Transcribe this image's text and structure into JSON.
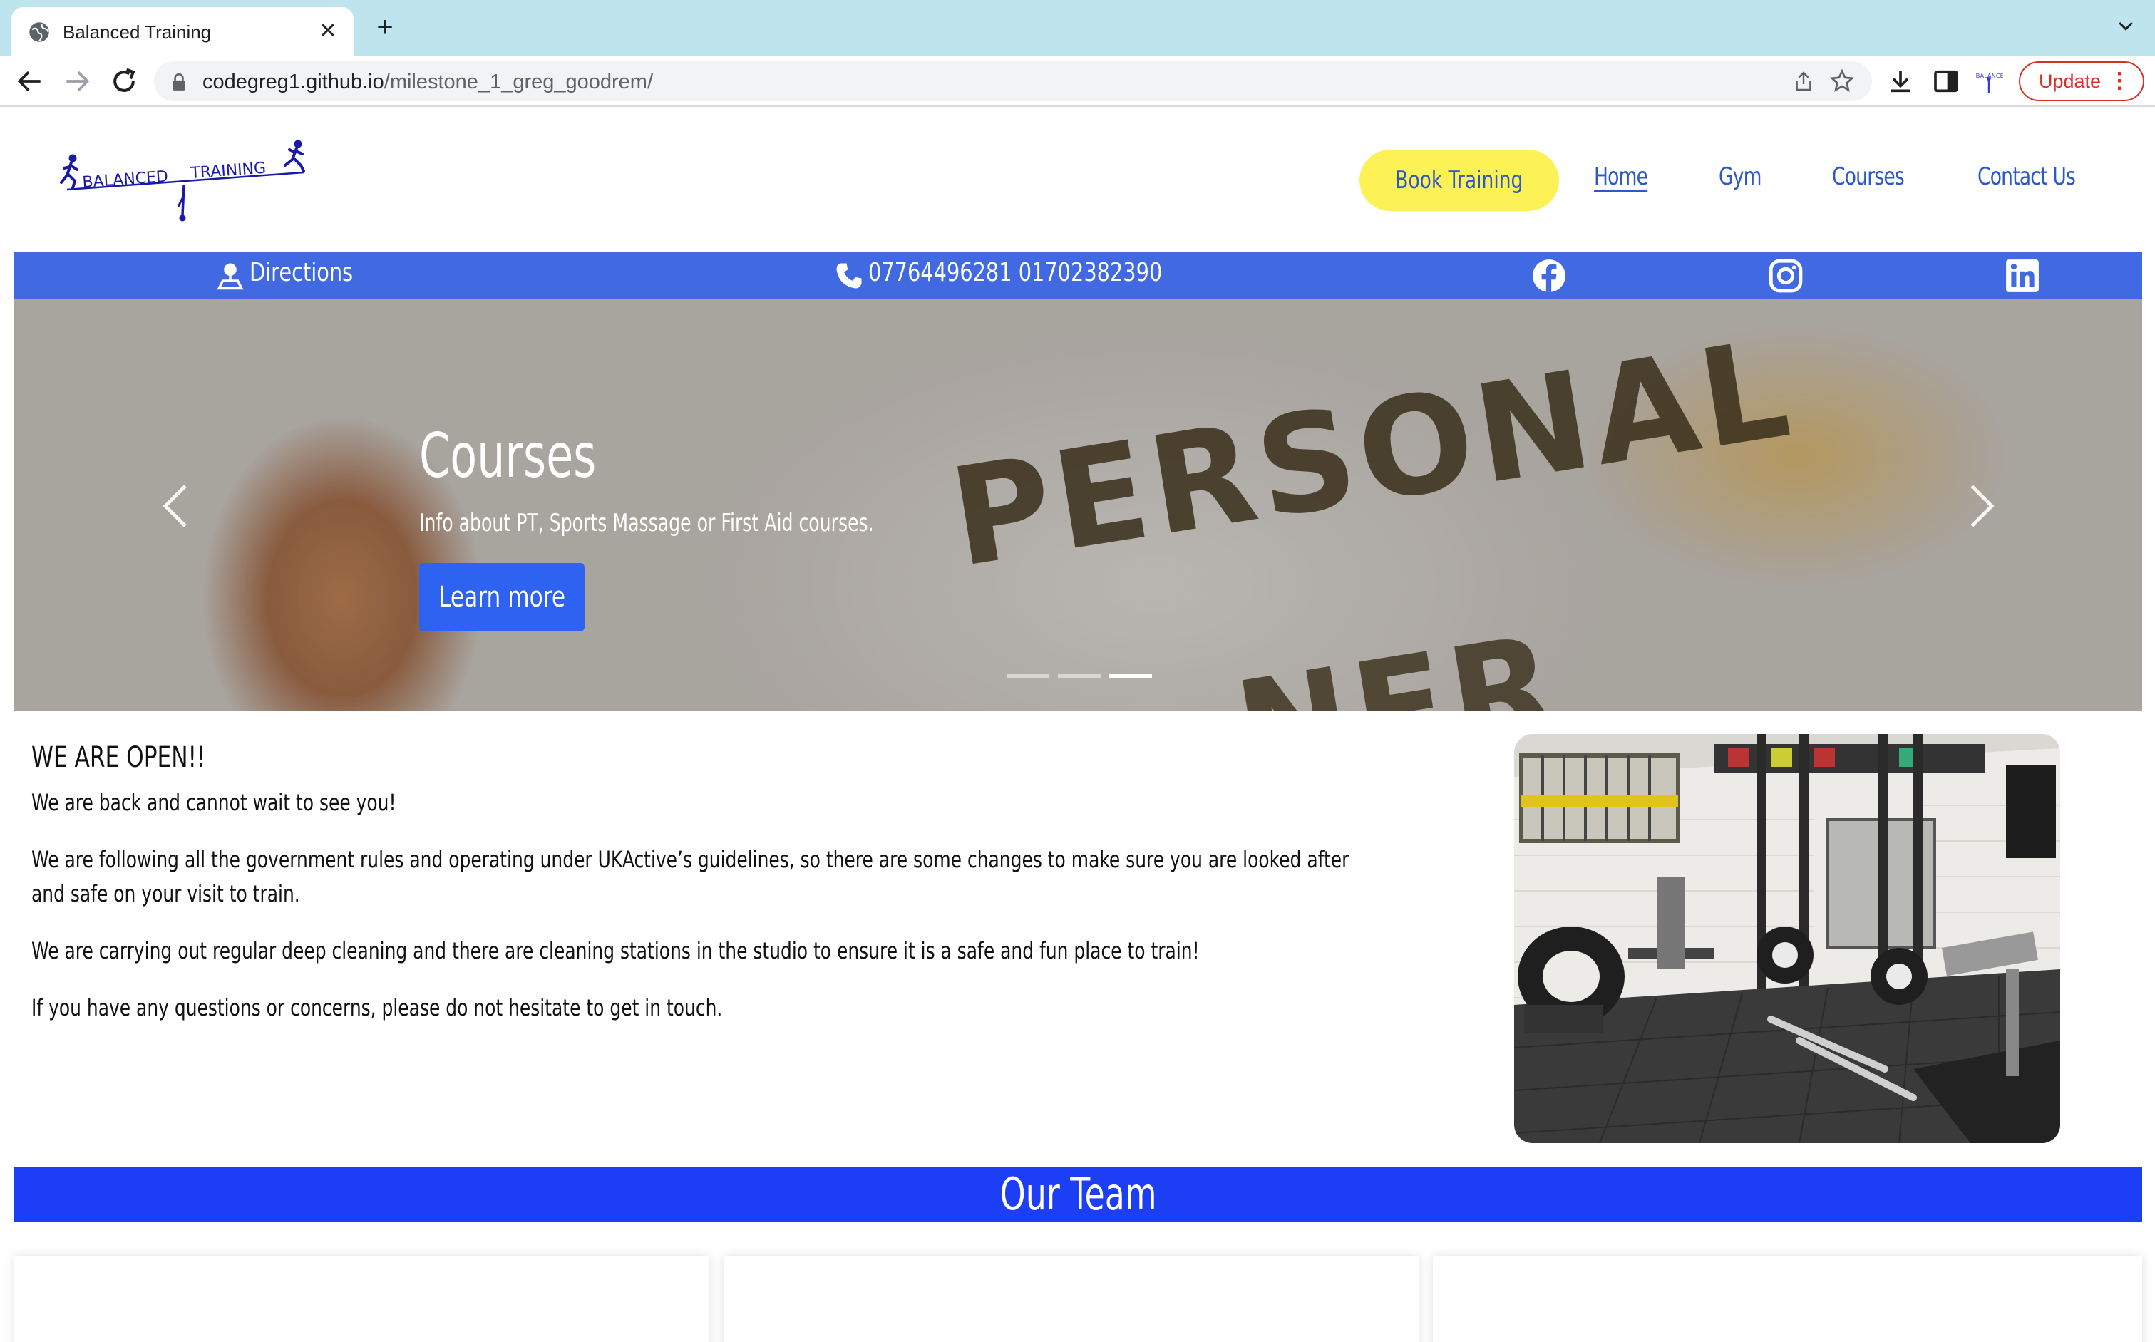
{
  "browser": {
    "tab_title": "Balanced Training",
    "tab_close": "✕",
    "new_tab": "+",
    "url_host": "codegreg1.github.io",
    "url_path": "/milestone_1_greg_goodrem/",
    "update_label": "Update",
    "update_menu": "⋮",
    "icons": [
      "back-icon",
      "forward-icon",
      "reload-icon",
      "lock-icon",
      "share-icon",
      "star-icon",
      "download-icon",
      "side-panel-icon",
      "profile-icon"
    ]
  },
  "site": {
    "logo_text_left": "BALANCED",
    "logo_text_right": "TRAINING",
    "nav": {
      "book": "Book Training",
      "home": "Home",
      "gym": "Gym",
      "courses": "Courses",
      "contact": "Contact Us"
    },
    "infobar": {
      "directions": "Directions",
      "phones": "07764496281 01702382390",
      "socials": [
        "facebook-icon",
        "instagram-icon",
        "linkedin-icon"
      ]
    },
    "carousel": {
      "title": "Courses",
      "text": "Info about PT, Sports Massage or First Aid courses.",
      "button": "Learn more",
      "slide_count": 3,
      "active_slide": 3,
      "image_text_1": "PERSONAL",
      "image_text_2": "NER"
    },
    "main": {
      "heading": "WE ARE OPEN!!",
      "paragraphs": [
        "We are back and cannot wait to see you!",
        "We are following all the government rules and operating under UKActive’s guidelines, so there are some changes to make sure you are looked after and safe on your visit to train.",
        "We are carrying out regular deep cleaning and there are cleaning stations in the studio to ensure it is a safe and fun place to train!",
        "If you have any questions or concerns, please do not hesitate to get in touch."
      ]
    },
    "team_heading": "Our Team"
  },
  "colors": {
    "tab_strip": "#bee4ed",
    "nav_text": "#2c58c9",
    "book_button": "#fcf155",
    "info_bar": "#4169e1",
    "learn_button": "#2d63f0",
    "team_bar": "#1c3ef5",
    "update_red": "#d93025"
  }
}
